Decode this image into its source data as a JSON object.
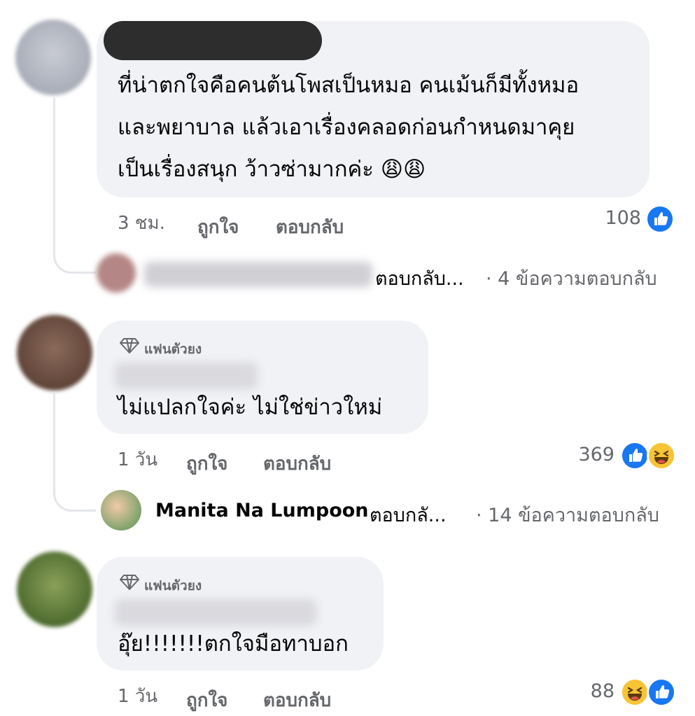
{
  "comments": [
    {
      "text_lines": [
        "ที่น่าตกใจคือคนต้นโพสเป็นหมอ คนเม้นก็มีทั้งหมอ",
        "และพยาบาล แล้วเอาเรื่องคลอดก่อนกำหนดมาคุย",
        "เป็นเรื่องสนุก ว้าวซ่ามากค่ะ 😩😩"
      ],
      "time": "3 ชม.",
      "like_label": "ถูกใจ",
      "reply_label": "ตอบกลับ",
      "reaction_count": "108",
      "reactions": [
        "like-icon"
      ],
      "reply_summary": {
        "preview": "ตอบกลับ...",
        "count": "· 4 ข้อความตอบกลับ"
      }
    },
    {
      "badge": "แฟนตัวยง",
      "text_lines": [
        "ไม่แปลกใจค่ะ ไม่ใช่ข่าวใหม่"
      ],
      "time": "1 วัน",
      "like_label": "ถูกใจ",
      "reply_label": "ตอบกลับ",
      "reaction_count": "369",
      "reactions": [
        "like-icon",
        "haha-icon"
      ],
      "reply_summary": {
        "name": "Manita Na Lumpoon",
        "preview": "ตอบกลั...",
        "count": "· 14 ข้อความตอบกลับ"
      }
    },
    {
      "badge": "แฟนตัวยง",
      "text_lines": [
        "อุ๊ย!!!!!!!ตกใจมือทาบอก"
      ],
      "time": "1 วัน",
      "like_label": "ถูกใจ",
      "reply_label": "ตอบกลับ",
      "reaction_count": "88",
      "reactions": [
        "haha-icon",
        "like-icon"
      ]
    }
  ],
  "colors": {
    "bubble": "#f0f2f5",
    "meta": "#65676b",
    "like": "#1877f2",
    "haha": "#f7c435"
  }
}
